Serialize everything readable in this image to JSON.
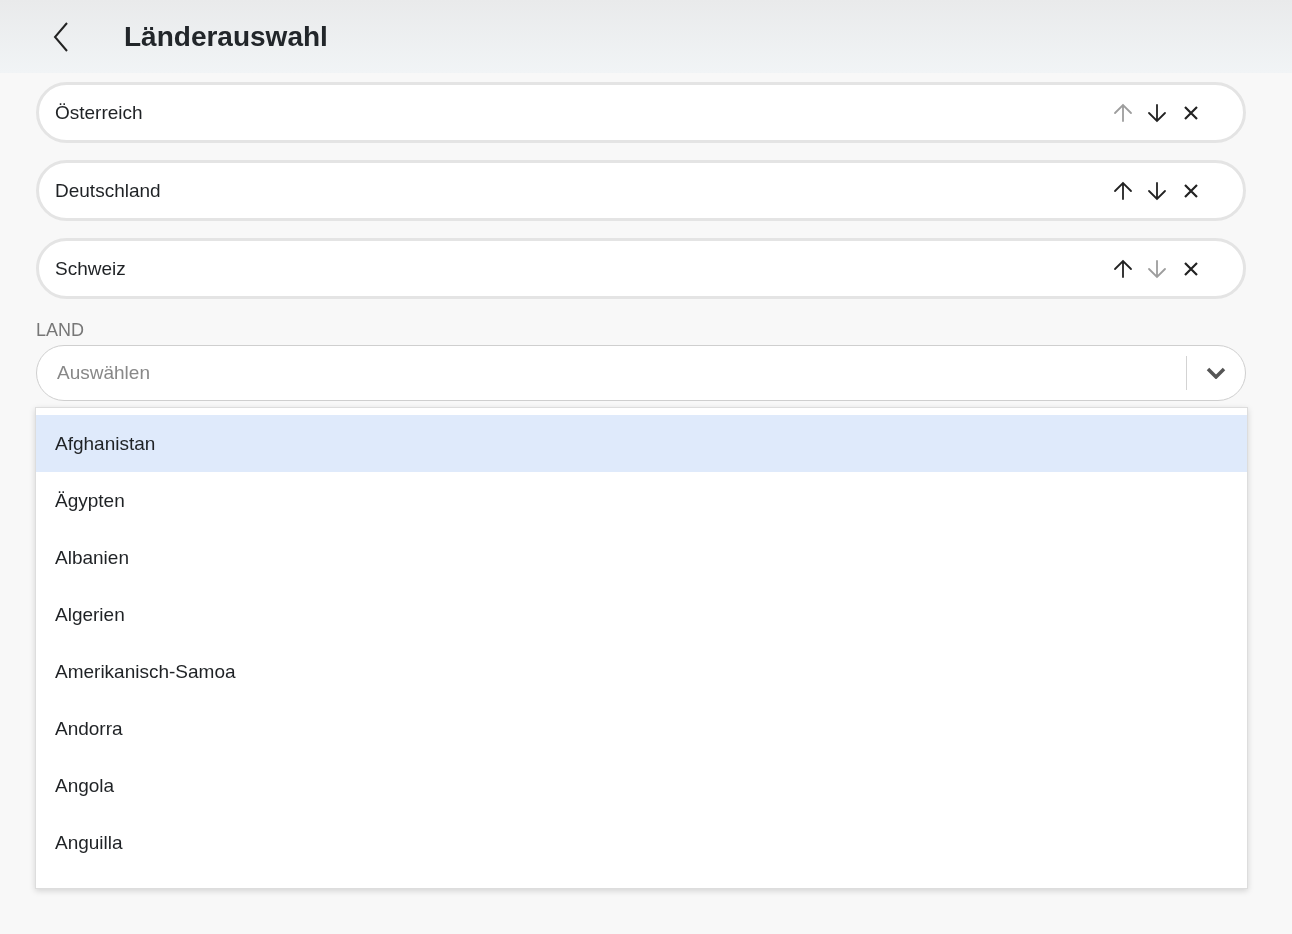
{
  "header": {
    "title": "Länderauswahl"
  },
  "selected_countries": [
    {
      "name": "Österreich",
      "up_disabled": true,
      "down_disabled": false
    },
    {
      "name": "Deutschland",
      "up_disabled": false,
      "down_disabled": false
    },
    {
      "name": "Schweiz",
      "up_disabled": false,
      "down_disabled": true
    }
  ],
  "country_select": {
    "label": "LAND",
    "placeholder": "Auswählen",
    "expanded": true
  },
  "options": [
    {
      "label": "Afghanistan",
      "selected": true
    },
    {
      "label": "Ägypten",
      "selected": false
    },
    {
      "label": "Albanien",
      "selected": false
    },
    {
      "label": "Algerien",
      "selected": false
    },
    {
      "label": "Amerikanisch-Samoa",
      "selected": false
    },
    {
      "label": "Andorra",
      "selected": false
    },
    {
      "label": "Angola",
      "selected": false
    },
    {
      "label": "Anguilla",
      "selected": false
    }
  ]
}
